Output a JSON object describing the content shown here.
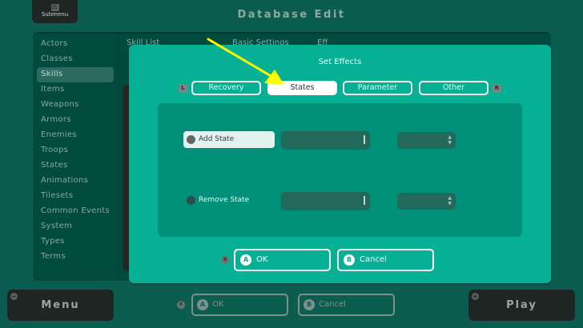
{
  "header": {
    "submenu_key": "ZL",
    "submenu_label": "Submenu",
    "title": "Database Edit"
  },
  "sidebar": {
    "items": [
      "Actors",
      "Classes",
      "Skills",
      "Items",
      "Weapons",
      "Armors",
      "Enemies",
      "Troops",
      "States",
      "Animations",
      "Tilesets",
      "Common Events",
      "System",
      "Types",
      "Terms"
    ],
    "selected": "Skills"
  },
  "columns": {
    "list": "Skill List",
    "basic": "Basic Settings",
    "effects": "Eff"
  },
  "modal": {
    "title": "Set Effects",
    "prev_key": "L",
    "next_key": "R",
    "tabs": [
      {
        "label": "Recovery"
      },
      {
        "label": "States",
        "active": true
      },
      {
        "label": "Parameter"
      },
      {
        "label": "Other"
      }
    ],
    "options": [
      {
        "label": "Add State",
        "selected": true,
        "state_value": "",
        "chance_value": ""
      },
      {
        "label": "Remove State",
        "selected": false,
        "state_value": "",
        "chance_value": ""
      }
    ],
    "x_key": "X",
    "ok_key": "A",
    "ok_label": "OK",
    "cancel_key": "B",
    "cancel_label": "Cancel"
  },
  "footer": {
    "menu_key": "−",
    "menu_label": "Menu",
    "x_key": "X",
    "ok_key": "A",
    "ok_label": "OK",
    "cancel_key": "B",
    "cancel_label": "Cancel",
    "play_key": "+",
    "play_label": "Play"
  },
  "colors": {
    "background": "#0b5d50",
    "modal": "#05b095",
    "inner": "#00907a",
    "annotation_arrow": "#ffff00"
  }
}
